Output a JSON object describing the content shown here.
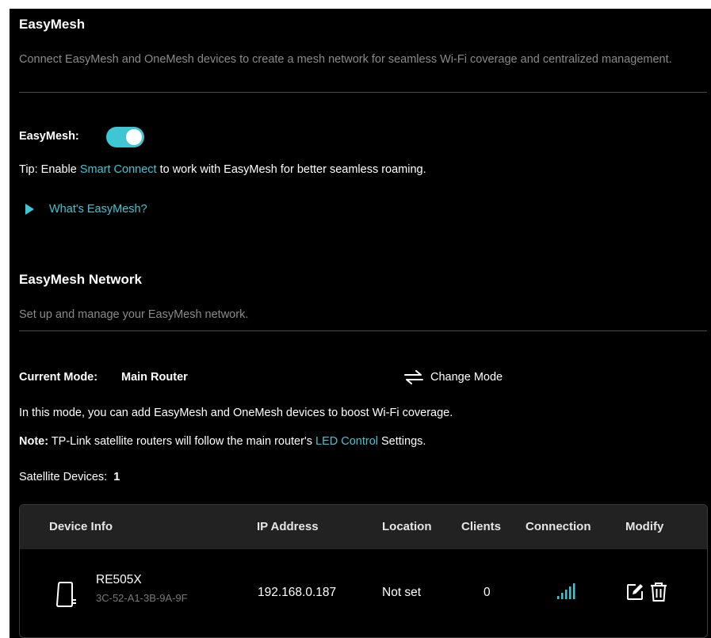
{
  "easymesh": {
    "title": "EasyMesh",
    "description": "Connect EasyMesh and OneMesh devices to create a mesh network for seamless Wi-Fi coverage and centralized management.",
    "toggle_label": "EasyMesh:",
    "toggle_state": "on",
    "tip_prefix": "Tip: Enable ",
    "tip_link": "Smart Connect",
    "tip_suffix": " to work with EasyMesh for better seamless roaming.",
    "whats_link": "What's EasyMesh?"
  },
  "network": {
    "title": "EasyMesh Network",
    "description": "Set up and manage your EasyMesh network.",
    "current_mode_label": "Current Mode:",
    "current_mode_value": "Main Router",
    "change_mode_label": "Change Mode",
    "mode_info": "In this mode, you can add EasyMesh and OneMesh devices to boost Wi-Fi coverage.",
    "note_label": "Note:",
    "note_prefix": " TP-Link satellite routers will follow the main router's ",
    "note_link": "LED Control",
    "note_suffix": " Settings.",
    "satellite_label": "Satellite Devices:",
    "satellite_count": "1"
  },
  "table": {
    "headers": [
      "Device Info",
      "IP Address",
      "Location",
      "Clients",
      "Connection",
      "Modify"
    ],
    "rows": [
      {
        "device_name": "RE505X",
        "mac": "3C-52-A1-3B-9A-9F",
        "ip": "192.168.0.187",
        "location": "Not set",
        "clients": "0",
        "connection_icon": "signal-bars-icon",
        "modify_icons": [
          "edit-icon",
          "delete-icon"
        ]
      }
    ]
  },
  "colors": {
    "accent": "#3ec6d4",
    "background": "#000000",
    "header_background": "#222222"
  }
}
